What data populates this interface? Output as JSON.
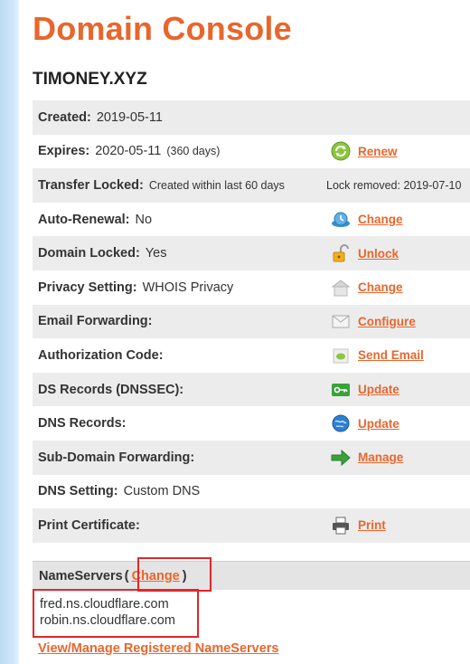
{
  "header": {
    "title": "Domain Console",
    "domain_name": "TIMONEY.XYZ"
  },
  "rows": [
    {
      "label": "Created:",
      "value": "2019-05-11"
    },
    {
      "label": "Expires:",
      "value": "2020-05-11",
      "note": "(360 days)",
      "action": "Renew",
      "icon": "renew-icon"
    },
    {
      "label": "Transfer Locked:",
      "note": "Created within last 60 days",
      "side_text": "Lock removed: 2019-07-10"
    },
    {
      "label": "Auto-Renewal:",
      "value": "No",
      "action": "Change",
      "icon": "clock-icon"
    },
    {
      "label": "Domain Locked:",
      "value": "Yes",
      "action": "Unlock",
      "icon": "padlock-icon"
    },
    {
      "label": "Privacy Setting:",
      "value": "WHOIS Privacy",
      "action": "Change",
      "icon": "house-icon"
    },
    {
      "label": "Email Forwarding:",
      "action": "Configure",
      "icon": "envelope-icon"
    },
    {
      "label": "Authorization Code:",
      "action": "Send Email",
      "icon": "email-send-icon"
    },
    {
      "label": "DS Records (DNSSEC):",
      "action": "Update",
      "icon": "key-icon"
    },
    {
      "label": "DNS Records:",
      "action": "Update",
      "icon": "globe-icon"
    },
    {
      "label": "Sub-Domain Forwarding:",
      "action": "Manage",
      "icon": "arrow-right-icon"
    },
    {
      "label": "DNS Setting:",
      "value": "Custom DNS"
    },
    {
      "label": "Print Certificate:",
      "action": "Print",
      "icon": "printer-icon"
    }
  ],
  "nameservers": {
    "label": "NameServers",
    "open_paren": "(",
    "change_label": "Change",
    "close_paren": ")",
    "servers": [
      "fred.ns.cloudflare.com",
      "robin.ns.cloudflare.com"
    ],
    "view_manage_link": "View/Manage Registered NameServers"
  },
  "colors": {
    "accent": "#e8662c",
    "highlight_box": "#e2262a",
    "row_shade": "#ececec",
    "sidebar": "#c8e2f6"
  }
}
